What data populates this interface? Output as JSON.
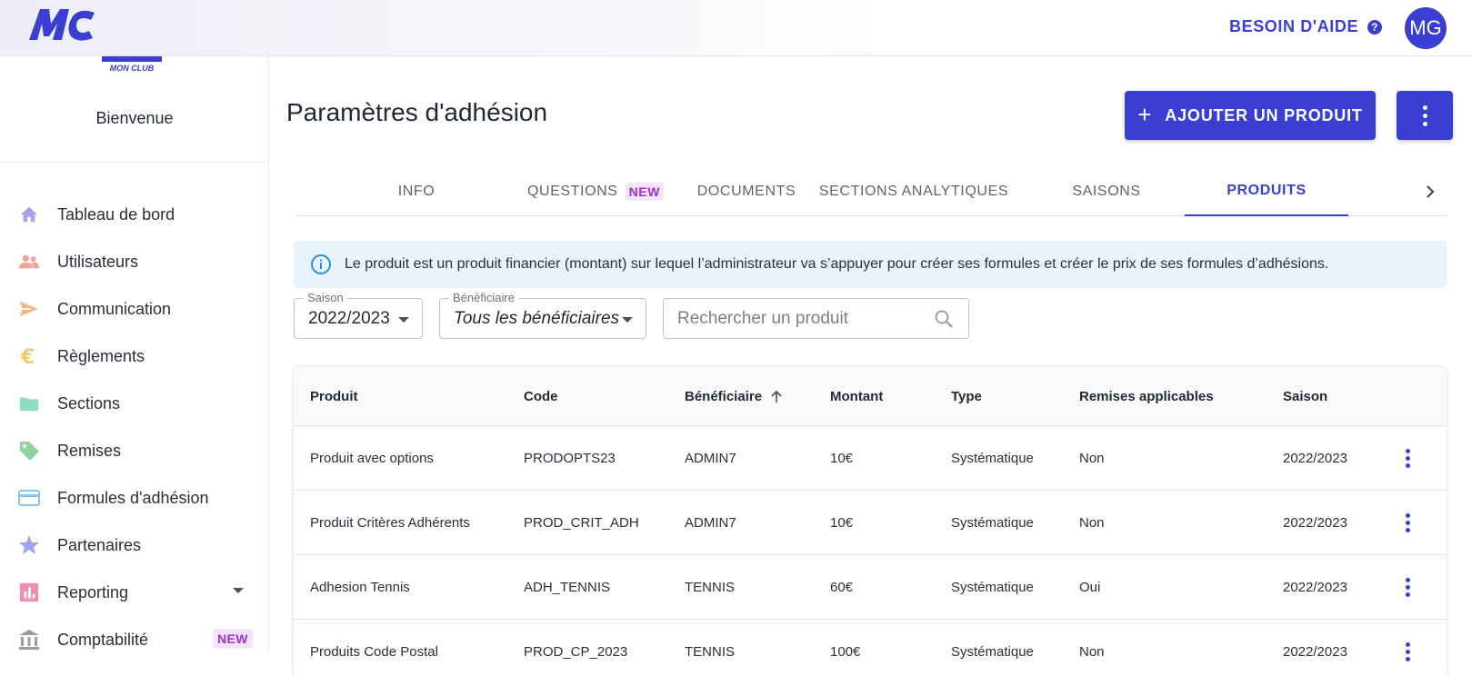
{
  "header": {
    "help_label": "BESOIN D'AIDE",
    "help_icon_glyph": "?",
    "help_icon": "question-circle-icon",
    "avatar_initials": "MG",
    "brand_color": "#3a3fd1",
    "logo_caption": "MON CLUB"
  },
  "sidebar": {
    "welcome": "Bienvenue",
    "items": [
      {
        "label": "Tableau de bord",
        "icon": "home-icon",
        "color": "#a9a2e6"
      },
      {
        "label": "Utilisateurs",
        "icon": "users-icon",
        "color": "#f2a59a"
      },
      {
        "label": "Communication",
        "icon": "send-icon",
        "color": "#f5b48a"
      },
      {
        "label": "Règlements",
        "icon": "euro-icon",
        "color": "#f3cb6e"
      },
      {
        "label": "Sections",
        "icon": "folder-icon",
        "color": "#8fdcc0"
      },
      {
        "label": "Remises",
        "icon": "tag-icon",
        "color": "#8fd39f"
      },
      {
        "label": "Formules d'adhésion",
        "icon": "credit-card-icon",
        "color": "#8ec3ea"
      },
      {
        "label": "Partenaires",
        "icon": "star-icon",
        "color": "#9aa7ef"
      },
      {
        "label": "Reporting",
        "icon": "bar-chart-icon",
        "color": "#f08fb1"
      },
      {
        "label": "Comptabilité",
        "icon": "bank-icon",
        "color": "#9a9ca3",
        "badge": "NEW"
      }
    ]
  },
  "main": {
    "title": "Paramètres d'adhésion",
    "add_button_label": "AJOUTER UN PRODUIT",
    "add_button_icon": "plus-icon",
    "tabs": [
      {
        "label": "INFO"
      },
      {
        "label": "QUESTIONS",
        "badge": "NEW"
      },
      {
        "label": "DOCUMENTS"
      },
      {
        "label": "SECTIONS ANALYTIQUES"
      },
      {
        "label": "SAISONS"
      },
      {
        "label": "PRODUITS",
        "active": true
      }
    ],
    "info_text": "Le produit est un produit financier (montant) sur lequel l’administrateur va s’appuyer pour créer ses formules et créer le prix de ses formules d’adhésions.",
    "filters": {
      "season_label": "Saison",
      "season_value": "2022/2023",
      "beneficiary_label": "Bénéficiaire",
      "beneficiary_value": "Tous les bénéficiaires",
      "search_placeholder": "Rechercher un produit"
    },
    "table": {
      "columns": [
        "Produit",
        "Code",
        "Bénéficiaire",
        "Montant",
        "Type",
        "Remises applicables",
        "Saison"
      ],
      "sort_column": "Bénéficiaire",
      "rows": [
        [
          "Produit avec options",
          "PRODOPTS23",
          "ADMIN7",
          "10€",
          "Systématique",
          "Non",
          "2022/2023"
        ],
        [
          "Produit Critères Adhérents",
          "PROD_CRIT_ADH",
          "ADMIN7",
          "10€",
          "Systématique",
          "Non",
          "2022/2023"
        ],
        [
          "Adhesion Tennis",
          "ADH_TENNIS",
          "TENNIS",
          "60€",
          "Systématique",
          "Oui",
          "2022/2023"
        ],
        [
          "Produits Code Postal",
          "PROD_CP_2023",
          "TENNIS",
          "100€",
          "Systématique",
          "Non",
          "2022/2023"
        ]
      ]
    }
  }
}
